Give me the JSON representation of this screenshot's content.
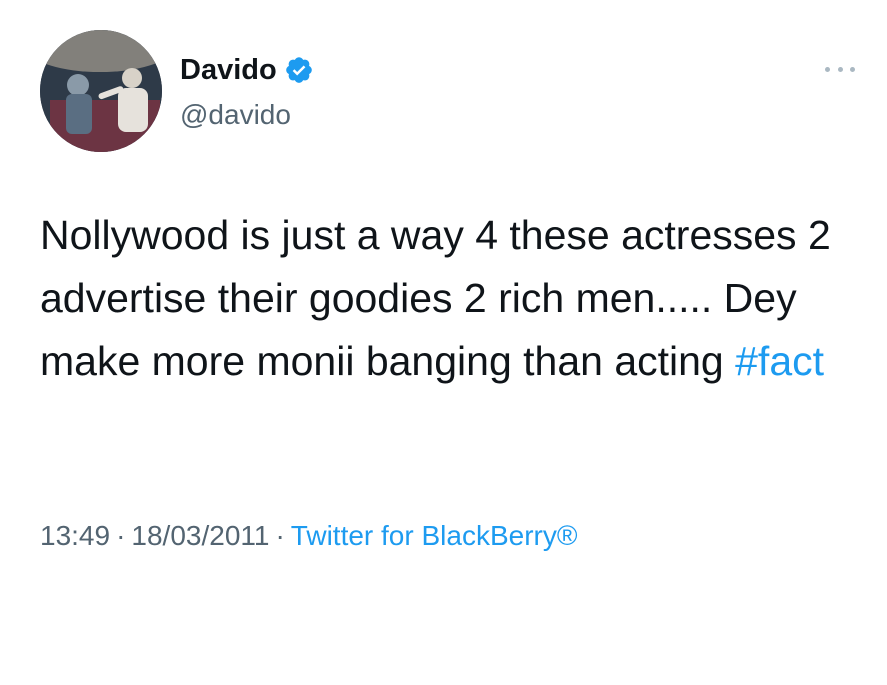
{
  "author": {
    "display_name": "Davido",
    "handle": "@davido",
    "verified": true,
    "avatar_icon": "user-avatar-photo"
  },
  "tweet": {
    "text": "Nollywood is just a way 4 these actresses 2 advertise their goodies 2 rich men..... Dey make more monii banging than acting ",
    "hashtag": "#fact"
  },
  "meta": {
    "time": "13:49",
    "separator": "·",
    "date": "18/03/2011",
    "source": "Twitter for BlackBerry®"
  },
  "icons": {
    "more": "more-options-icon",
    "verified": "verified-badge-icon"
  },
  "colors": {
    "link": "#1d9bf0",
    "secondary_text": "#536471",
    "primary_text": "#0f1419",
    "background": "#ffffff"
  }
}
